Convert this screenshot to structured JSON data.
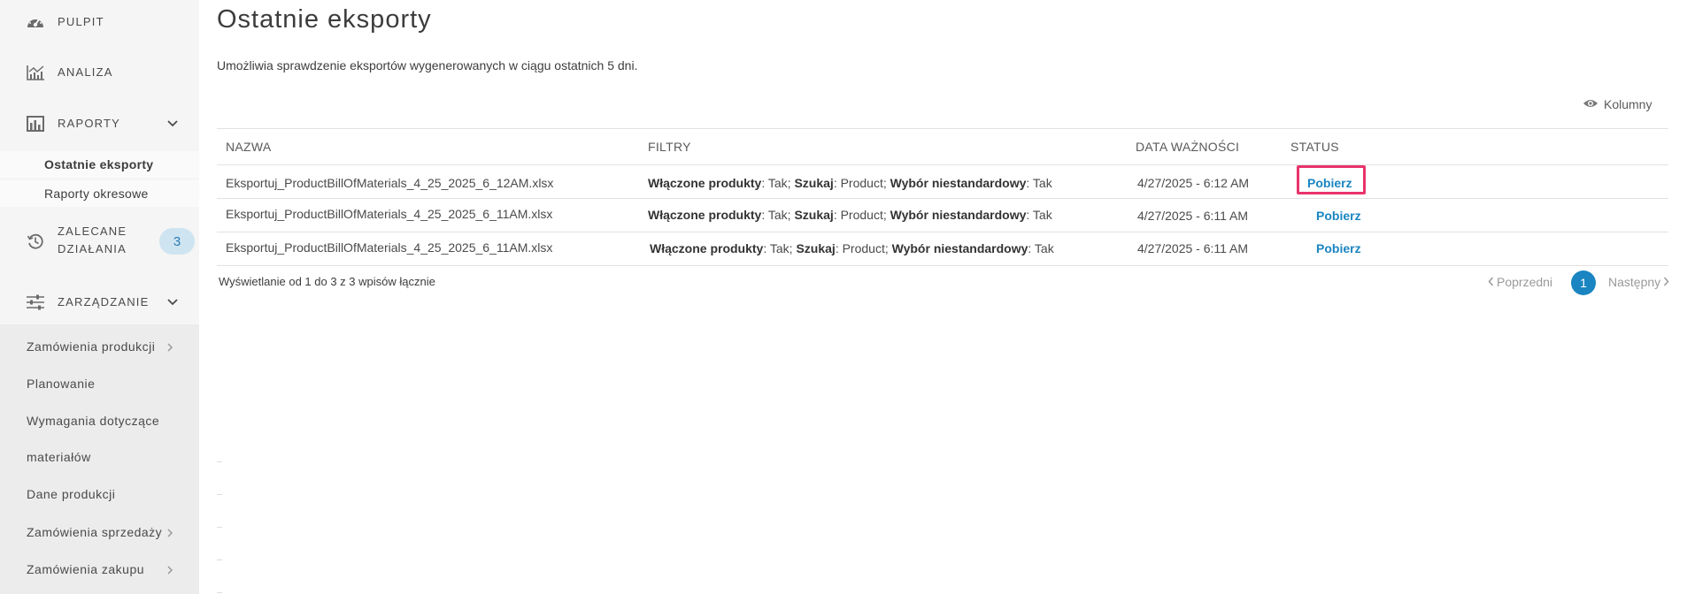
{
  "sidebar": {
    "dashboard": "PULPIT",
    "analysis": "ANALIZA",
    "reports": "RAPORTY",
    "reports_sub": [
      "Ostatnie eksporty",
      "Raporty okresowe"
    ],
    "recommended_line1": "ZALECANE",
    "recommended_line2": "DZIAŁANIA",
    "recommended_count": "3",
    "management": "ZARZĄDZANIE",
    "management_items": [
      "Zamówienia produkcji",
      "Planowanie",
      "Wymagania dotyczące",
      "materiałów",
      "Dane produkcji",
      "Zamówienia sprzedaży",
      "Zamówienia zakupu"
    ]
  },
  "main": {
    "title": "Ostatnie eksporty",
    "description": "Umożliwia sprawdzenie eksportów wygenerowanych w ciągu ostatnich 5 dni.",
    "columns_button": "Kolumny",
    "table": {
      "headers": [
        "NAZWA",
        "FILTRY",
        "DATA WAŻNOŚCI",
        "STATUS"
      ],
      "rows": [
        {
          "name": "Eksportuj_ProductBillOfMaterials_4_25_2025_6_12AM.xlsx",
          "filter_k1": "Włączone produkty",
          "filter_v1": ": Tak; ",
          "filter_k2": "Szukaj",
          "filter_v2": ": Product; ",
          "filter_k3": "Wybór niestandardowy",
          "filter_v3": ": Tak",
          "expiry": "4/27/2025 - 6:12 AM",
          "status": "Pobierz"
        },
        {
          "name": "Eksportuj_ProductBillOfMaterials_4_25_2025_6_11AM.xlsx",
          "filter_k1": "Włączone produkty",
          "filter_v1": ": Tak; ",
          "filter_k2": "Szukaj",
          "filter_v2": ": Product; ",
          "filter_k3": "Wybór niestandardowy",
          "filter_v3": ": Tak",
          "expiry": "4/27/2025 - 6:11 AM",
          "status": "Pobierz"
        },
        {
          "name": "Eksportuj_ProductBillOfMaterials_4_25_2025_6_11AM.xlsx",
          "filter_k1": "Włączone produkty",
          "filter_v1": ": Tak; ",
          "filter_k2": "Szukaj",
          "filter_v2": ": Product; ",
          "filter_k3": "Wybór niestandardowy",
          "filter_v3": ": Tak",
          "expiry": "4/27/2025 - 6:11 AM",
          "status": "Pobierz"
        }
      ]
    },
    "footer": "Wyświetlanie od 1 do 3 z 3 wpisów łącznie",
    "pagination": {
      "prev": "Poprzedni",
      "current": "1",
      "next": "Następny"
    }
  },
  "colors": {
    "accent": "#1a85c1",
    "highlight": "#e8336b",
    "badge_bg": "#cfe4f1"
  }
}
